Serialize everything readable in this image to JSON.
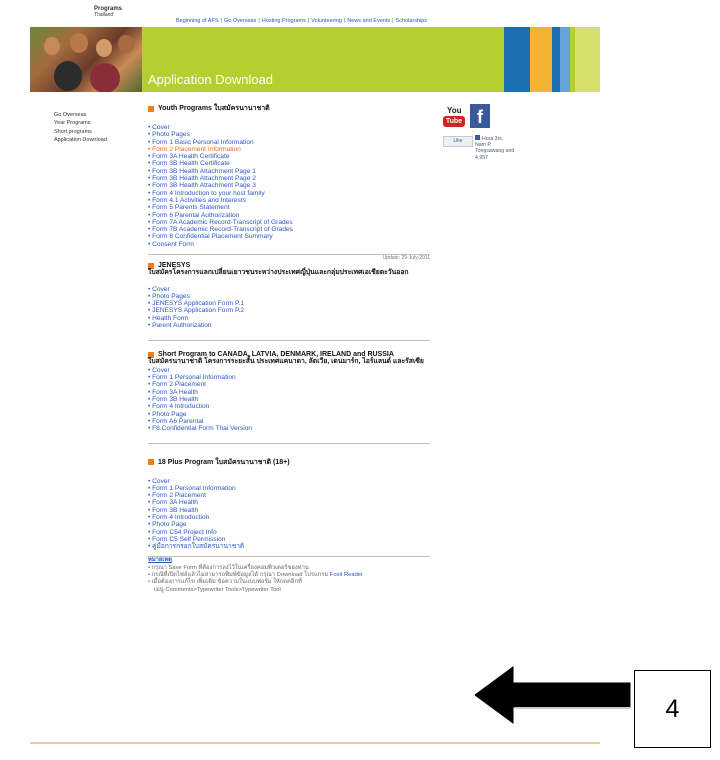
{
  "logo": {
    "line1": "Programs",
    "line2": "Thailand"
  },
  "topnav": [
    "Beginning of AFS",
    "Go Overseas",
    "Hosting Programs",
    "Volunteering",
    "News and Events",
    "Scholarships"
  ],
  "banner": {
    "title": "Application Download"
  },
  "leftnav": [
    "Go Overseas",
    "Year Programs",
    "Short programs",
    "Application Download"
  ],
  "youth": {
    "title": "Youth Programs ใบสมัครนานาชาติ",
    "items": [
      "Cover",
      "Photo Pages",
      "Form 1 Basic Personal Information",
      "Form 2 Placement Information",
      "Form 3A Health Certificate",
      "Form 3B Health Certificate",
      "Form 3B Health Attachment Page 1",
      "Form 3B Health Attachment Page 2",
      "Form 3B Health Attachment Page 3",
      "Form 4 Introduction to your host family",
      "Form 4.1 Activities and Interests",
      "Form 5 Parents Statement",
      "Form 6 Parental Authorization",
      "Form 7A Academic Record-Transcript of Grades",
      "Form 7B Academic Record-Transcript of Grades",
      "Form 8 Confidential Placement Summary",
      "Consent Form"
    ],
    "active_index": 3,
    "update": "Update: 29-July-2011"
  },
  "jenesys": {
    "title": "JENESYS",
    "thai": "ใบสมัครโครงการแลกเปลี่ยนเยาวชนระหว่างประเทศญี่ปุ่นและกลุ่มประเทศเอเชียตะวันออก",
    "items": [
      "Cover",
      "Photo Pages",
      "JENESYS Application Form P.1",
      "JENESYS Application Form P.2",
      "Health Form",
      "Parent Authorization"
    ]
  },
  "short": {
    "title": "Short Program to CANADA, LATVIA, DENMARK, IRELAND and RUSSIA",
    "thai": "ใบสมัครนานาชาติ โครงการระยะสั้น ประเทศแคนาดา, ลัตเวีย, เดนมาร์ก, ไอร์แลนด์ และรัสเซีย",
    "items": [
      "Cover",
      "Form 1 Personal Information",
      "Form 2 Placement",
      "Form 3A Health",
      "Form 3B Health",
      "Form 4 Introduction",
      "Photo Page",
      "Form A6 Parental",
      "F8 Confidential Form Thai Version"
    ]
  },
  "plus18": {
    "title": "18 Plus Program ใบสมัครนานาชาติ (18+)",
    "items": [
      "Cover",
      "Form 1 Personal Information",
      "Form 2 Placement",
      "Form 3A Health",
      "Form 3B Health",
      "Form 4 Introduction",
      "Photo Page",
      "Form C54 Project Info",
      "Form C5 Self Permission",
      "คู่มือการกรอกใบสมัครนานาชาติ"
    ]
  },
  "notes": {
    "heading": "หมายเหตุ",
    "line1": "กรุณา Save Form ที่ต้องการลงไว้ในเครื่องคอมพิวเตอร์ของท่าน",
    "line2a": "กรณีที่เปิดไฟล์แล้วไม่สามารถพิมพ์ข้อมูลได้ กรุณา Download โปรแกรม",
    "line2b": "Foxit Reader",
    "line3": "เมื่อต้องการแก้ไข เพิ่มเติม ข้อความในแบบฟอร์ม ให้กดคลิกที่",
    "line4": "เมนู Comments>Typewriter Tools>Typewriter Tool"
  },
  "social": {
    "you": "You",
    "tube": "Tube",
    "fb": "f",
    "like": "Like",
    "fans": "Hora 3rs, Nam P. Tongsawang and 4,957"
  },
  "callout": {
    "number": "4"
  },
  "colors": {
    "banner_green": "#b4cf2f",
    "link_blue": "#2a56c6",
    "accent_orange": "#f07c1a"
  }
}
